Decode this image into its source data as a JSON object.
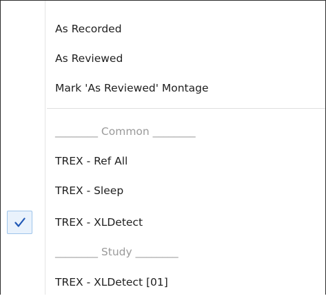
{
  "menu": {
    "items": [
      {
        "label": "As Recorded",
        "type": "item",
        "checked": false
      },
      {
        "label": "As Reviewed",
        "type": "item",
        "checked": false
      },
      {
        "label": "Mark 'As Reviewed' Montage",
        "type": "item",
        "checked": false
      },
      {
        "label": "________ Common ________",
        "type": "header",
        "checked": false
      },
      {
        "label": "TREX - Ref All",
        "type": "item",
        "checked": false
      },
      {
        "label": "TREX - Sleep",
        "type": "item",
        "checked": false
      },
      {
        "label": "TREX - XLDetect",
        "type": "item",
        "checked": true
      },
      {
        "label": "________ Study ________",
        "type": "header",
        "checked": false
      },
      {
        "label": "TREX - XLDetect [01]",
        "type": "item",
        "checked": false
      }
    ],
    "check_icon": "checkmark-icon",
    "colors": {
      "check": "#1f57b5",
      "check_background": "#e9f2fc",
      "check_border": "#9ec4ea",
      "header_text": "#9a9a9a",
      "border": "#2b2b2b"
    }
  }
}
